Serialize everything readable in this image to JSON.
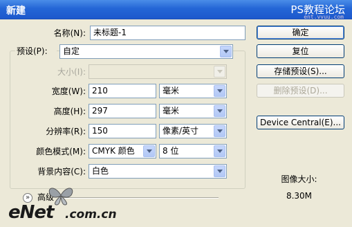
{
  "window": {
    "title": "新建"
  },
  "watermarks": {
    "top_right": "PS教程论坛",
    "top_right_small": "ent.vvuu.com",
    "bottom_left_main": "eNet",
    "bottom_left_suffix": ".com.cn"
  },
  "form": {
    "name": {
      "label": "名称(N):",
      "value": "未标题-1"
    },
    "preset": {
      "label": "预设(P):",
      "value": "自定"
    },
    "size": {
      "label": "大小(I):",
      "value": ""
    },
    "width": {
      "label": "宽度(W):",
      "value": "210",
      "unit": "毫米"
    },
    "height": {
      "label": "高度(H):",
      "value": "297",
      "unit": "毫米"
    },
    "resolution": {
      "label": "分辨率(R):",
      "value": "150",
      "unit": "像素/英寸"
    },
    "color_mode": {
      "label": "颜色模式(M):",
      "value": "CMYK 颜色",
      "bits": "8 位"
    },
    "background": {
      "label": "背景内容(C):",
      "value": "白色"
    },
    "advanced": {
      "label": "高级"
    }
  },
  "buttons": {
    "ok": "确定",
    "reset": "复位",
    "save_preset": "存储预设(S)...",
    "delete_preset": "删除预设(D)...",
    "device_central": "Device Central(E)..."
  },
  "image_size": {
    "label": "图像大小:",
    "value": "8.30M"
  }
}
